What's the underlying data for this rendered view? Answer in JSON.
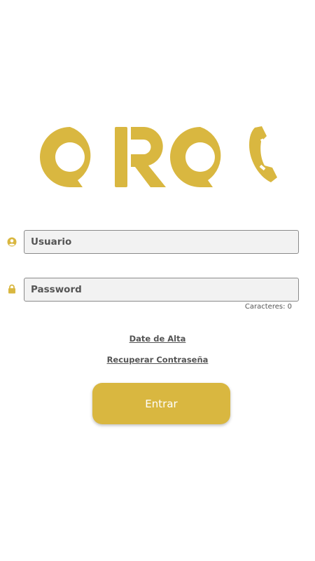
{
  "brand": {
    "logo_text": "OROC",
    "accent_color": "#d9b740"
  },
  "login": {
    "username": {
      "placeholder": "Usuario",
      "value": "",
      "icon": "user-circle-icon"
    },
    "password": {
      "placeholder": "Password",
      "value": "",
      "icon": "lock-icon"
    },
    "char_count": "Caracteres: 0",
    "signup_link": "Date de Alta",
    "recover_link": "Recuperar Contraseña",
    "submit_label": "Entrar"
  }
}
